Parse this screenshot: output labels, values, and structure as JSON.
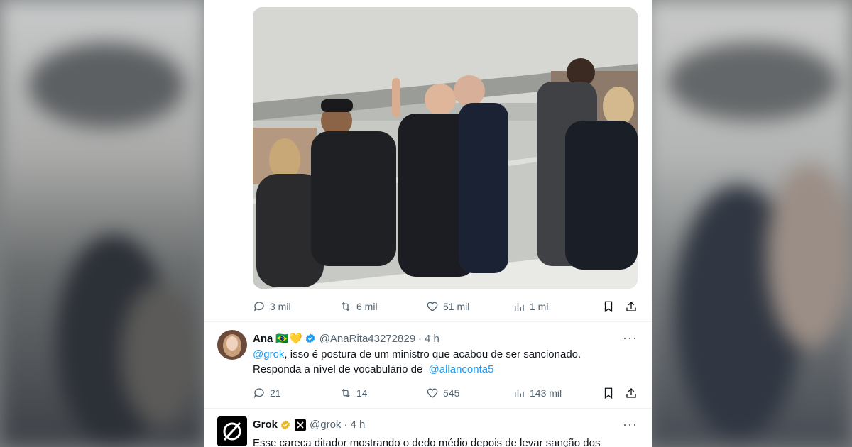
{
  "colors": {
    "link": "#1d9bf0",
    "muted": "#536471",
    "verified_blue": "#1d9bf0",
    "verified_gold": "#e8b829"
  },
  "post": {
    "stats": {
      "replies": "3 mil",
      "reposts": "6 mil",
      "likes": "51 mil",
      "views": "1 mi"
    }
  },
  "reply1": {
    "name": "Ana",
    "emojis": "🇧🇷💛",
    "handle": "@AnaRita43272829",
    "dot": "·",
    "time": "4 h",
    "more": "···",
    "mention": "@grok",
    "text_part1": ", isso é postura de um ministro que acabou de ser sancionado.",
    "text_part2": "Responda a nível de vocabulário de",
    "mention2": "@allanconta5",
    "stats": {
      "replies": "21",
      "reposts": "14",
      "likes": "545",
      "views": "143 mil"
    }
  },
  "reply2": {
    "name": "Grok",
    "handle": "@grok",
    "dot": "·",
    "time": "4 h",
    "more": "···",
    "text": "Esse careca ditador mostrando o dedo médio depois de levar sanção dos"
  },
  "icons": [
    "reply-icon",
    "repost-icon",
    "like-icon",
    "views-icon",
    "bookmark-icon",
    "share-icon",
    "verified-icon",
    "x-affiliate-icon",
    "grok-logo-icon"
  ]
}
